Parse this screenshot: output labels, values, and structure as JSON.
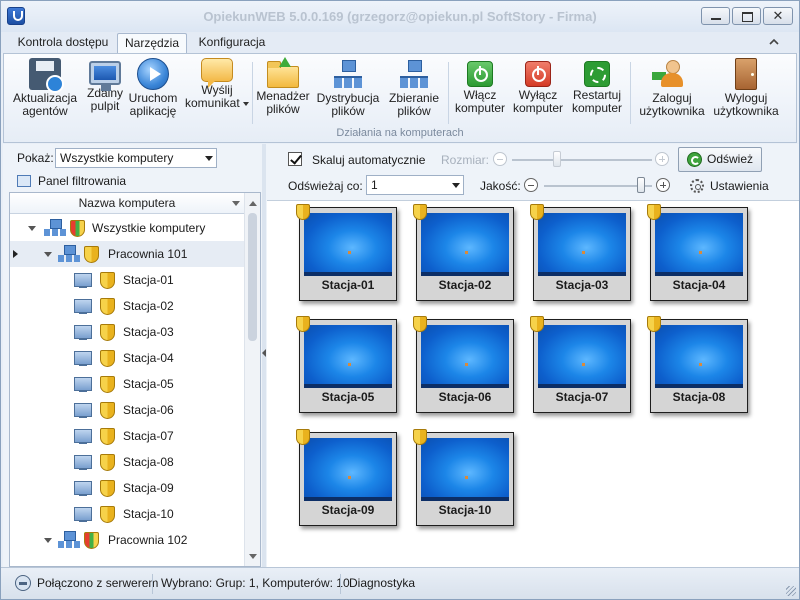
{
  "window": {
    "title": "OpiekunWEB 5.0.0.169  (grzegorz@opiekun.pl SoftStory - Firma)",
    "close_glyph": "✕"
  },
  "tabs": [
    {
      "label": "Kontrola dostępu"
    },
    {
      "label": "Narzędzia",
      "active": true
    },
    {
      "label": "Konfiguracja"
    }
  ],
  "ribbon": {
    "group_label": "Działania na komputerach",
    "buttons": [
      {
        "line1": "Aktualizacja",
        "line2": "agentów",
        "icon": "floppy-disk-icon"
      },
      {
        "line1": "Zdalny",
        "line2": "pulpit",
        "icon": "monitor-icon"
      },
      {
        "line1": "Uruchom",
        "line2": "aplikację",
        "icon": "play-icon"
      },
      {
        "line1": "Wyślij",
        "line2": "komunikat",
        "icon": "message-icon",
        "dropdown": true
      },
      {
        "line1": "Menadżer",
        "line2": "plików",
        "icon": "folder-icon"
      },
      {
        "line1": "Dystrybucja",
        "line2": "plików",
        "icon": "network-distribute-icon"
      },
      {
        "line1": "Zbieranie",
        "line2": "plików",
        "icon": "network-collect-icon"
      },
      {
        "line1": "Włącz",
        "line2": "komputer",
        "icon": "power-on-icon"
      },
      {
        "line1": "Wyłącz",
        "line2": "komputer",
        "icon": "power-off-icon"
      },
      {
        "line1": "Restartuj",
        "line2": "komputer",
        "icon": "restart-icon"
      },
      {
        "line1": "Zaloguj",
        "line2": "użytkownika",
        "icon": "user-login-icon"
      },
      {
        "line1": "Wyloguj",
        "line2": "użytkownika",
        "icon": "door-logout-icon"
      }
    ]
  },
  "left_panel": {
    "show_label": "Pokaż:",
    "show_value": "Wszystkie komputery",
    "filter_panel_label": "Panel filtrowania",
    "tree_header": "Nazwa komputera",
    "tree": [
      {
        "label": "Wszystkie komputery",
        "level": 0,
        "type": "group"
      },
      {
        "label": "Pracownia 101",
        "level": 1,
        "type": "group",
        "selected": true
      },
      {
        "label": "Stacja-01",
        "level": 2,
        "type": "computer"
      },
      {
        "label": "Stacja-02",
        "level": 2,
        "type": "computer"
      },
      {
        "label": "Stacja-03",
        "level": 2,
        "type": "computer"
      },
      {
        "label": "Stacja-04",
        "level": 2,
        "type": "computer"
      },
      {
        "label": "Stacja-05",
        "level": 2,
        "type": "computer"
      },
      {
        "label": "Stacja-06",
        "level": 2,
        "type": "computer"
      },
      {
        "label": "Stacja-07",
        "level": 2,
        "type": "computer"
      },
      {
        "label": "Stacja-08",
        "level": 2,
        "type": "computer"
      },
      {
        "label": "Stacja-09",
        "level": 2,
        "type": "computer"
      },
      {
        "label": "Stacja-10",
        "level": 2,
        "type": "computer"
      },
      {
        "label": "Pracownia 102",
        "level": 1,
        "type": "group"
      }
    ]
  },
  "right_panel": {
    "scale_auto_label": "Skaluj automatycznie",
    "scale_auto_checked": true,
    "size_label": "Rozmiar:",
    "refresh_button": "Odśwież",
    "refresh_every_label": "Odświeżaj co:",
    "refresh_every_value": "1",
    "quality_label": "Jakość:",
    "quality_level": 0.9,
    "settings_label": "Ustawienia",
    "thumbnails": [
      "Stacja-01",
      "Stacja-02",
      "Stacja-03",
      "Stacja-04",
      "Stacja-05",
      "Stacja-06",
      "Stacja-07",
      "Stacja-08",
      "Stacja-09",
      "Stacja-10"
    ]
  },
  "statusbar": {
    "connection": "Połączono z serwerem",
    "selection": "Wybrano: Grup: 1, Komputerów: 10",
    "diagnostics": "Diagnostyka"
  }
}
